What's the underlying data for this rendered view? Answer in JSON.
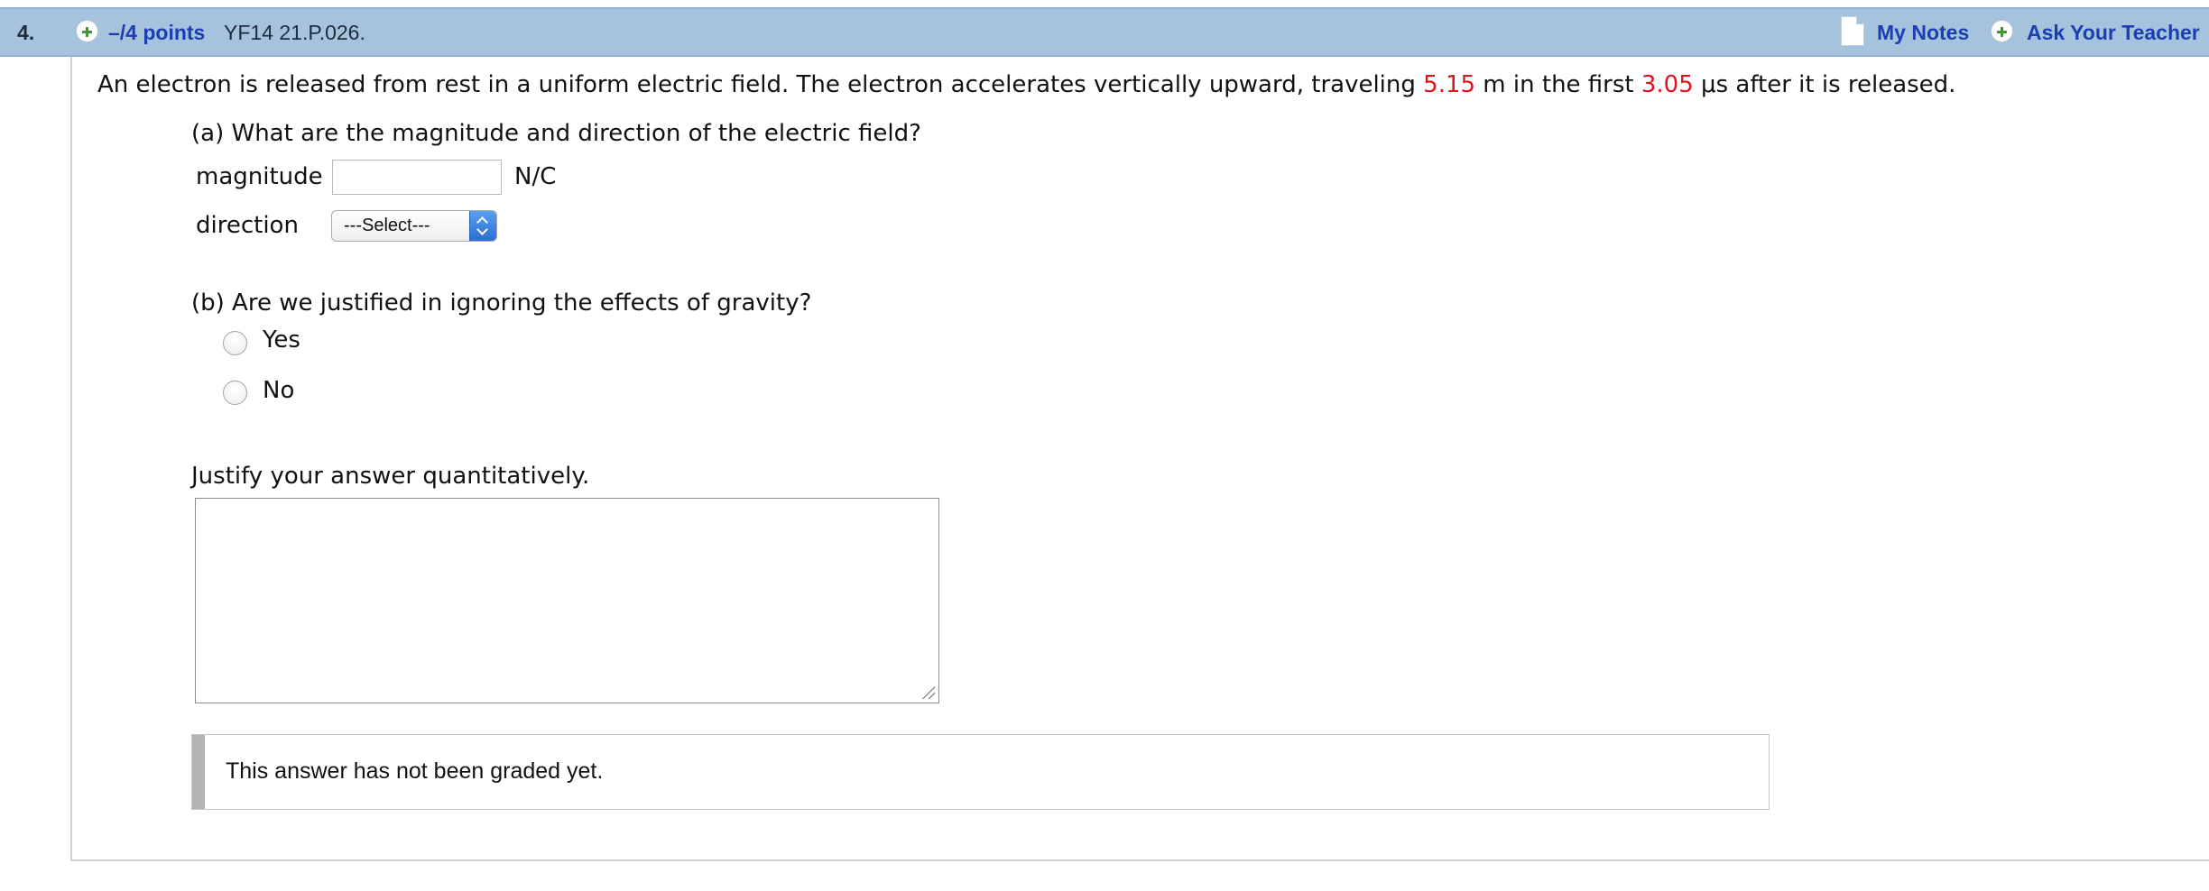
{
  "header": {
    "question_number": "4.",
    "points": "–/4 points",
    "question_code": "YF14 21.P.026.",
    "my_notes": "My Notes",
    "ask_teacher": "Ask Your Teacher"
  },
  "question": {
    "prompt_before_distance": "An electron is released from rest in a uniform electric field. The electron accelerates vertically upward, traveling ",
    "distance": "5.15",
    "prompt_middle": " m in the first ",
    "time": "3.05",
    "prompt_after_time": " μs after it is released.",
    "highlight_color": "#e0121f"
  },
  "part_a": {
    "question": "(a) What are the magnitude and direction of the electric field?",
    "magnitude_label": "magnitude",
    "magnitude_value": "",
    "magnitude_unit": "N/C",
    "direction_label": "direction",
    "direction_selected": "---Select---"
  },
  "part_b": {
    "question": "(b) Are we justified in ignoring the effects of gravity?",
    "options": [
      {
        "label": "Yes",
        "selected": false
      },
      {
        "label": "No",
        "selected": false
      }
    ]
  },
  "justify": {
    "label": "Justify your answer quantitatively.",
    "value": ""
  },
  "grading": {
    "status_text": "This answer has not been graded yet."
  },
  "icons": {
    "points_toggle": "plus-circle-icon",
    "notes": "note-page-icon",
    "ask_teacher": "plus-circle-icon",
    "select_arrows": "updown-chevron-icon",
    "resize": "resize-grip-icon"
  },
  "colors": {
    "header_bar": "#a6c3de",
    "link": "#1b3fb0",
    "select_button": "#2a6fd6"
  }
}
